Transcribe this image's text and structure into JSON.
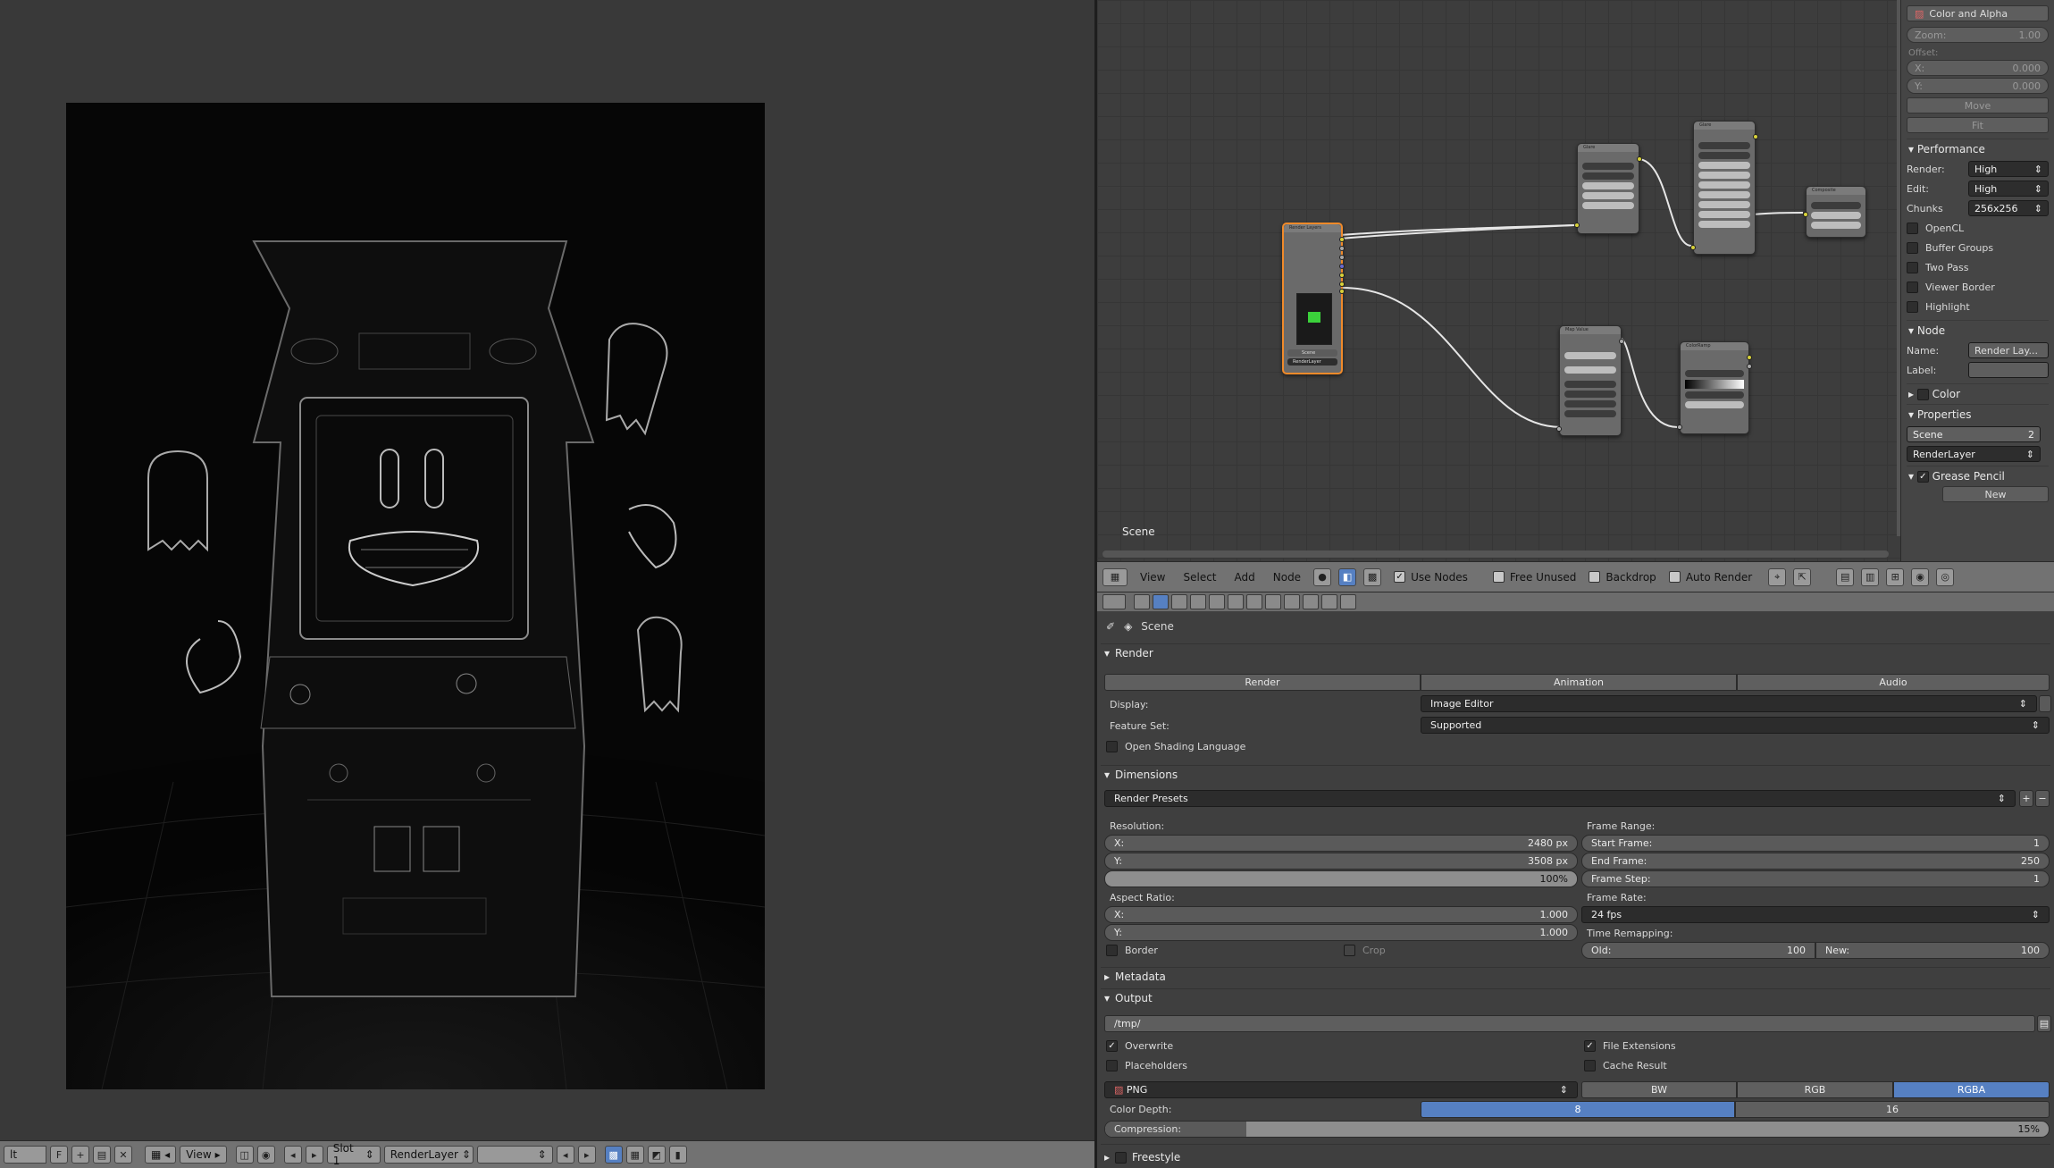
{
  "image_editor": {
    "header": {
      "image_name": "lt",
      "f_label": "F",
      "view_menu": "View",
      "slot": "Slot 1",
      "layer": "RenderLayer"
    }
  },
  "node_editor": {
    "frame_label": "Scene",
    "nodes": {
      "render_layers": "Render Layers",
      "glare1": "Glare",
      "glare2": "Glare",
      "composite": "Composite",
      "map_value": "Map Value",
      "color_ramp": "ColorRamp",
      "render_layer_field": "RenderLayer",
      "scene_field": "Scene"
    },
    "header": {
      "menus": [
        "View",
        "Select",
        "Add",
        "Node"
      ],
      "use_nodes": "Use Nodes",
      "free_unused": "Free Unused",
      "backdrop": "Backdrop",
      "auto_render": "Auto Render"
    }
  },
  "node_props": {
    "color_alpha": "Color and Alpha",
    "zoom_label": "Zoom:",
    "zoom_value": "1.00",
    "offset_label": "Offset:",
    "x_label": "X:",
    "x_value": "0.000",
    "y_label": "Y:",
    "y_value": "0.000",
    "move": "Move",
    "fit": "Fit",
    "performance": "Performance",
    "render_label": "Render:",
    "render_value": "High",
    "edit_label": "Edit:",
    "edit_value": "High",
    "chunks_label": "Chunks",
    "chunks_value": "256x256",
    "opencl": "OpenCL",
    "buffer_groups": "Buffer Groups",
    "two_pass": "Two Pass",
    "viewer_border": "Viewer Border",
    "highlight": "Highlight",
    "node_header": "Node",
    "name_label": "Name:",
    "name_value": "Render Lay...",
    "label_label": "Label:",
    "color_header": "Color",
    "properties_header": "Properties",
    "scene_value": "Scene",
    "scene_count": "2",
    "renderlayer_value": "RenderLayer",
    "grease_pencil": "Grease Pencil",
    "new_btn": "New"
  },
  "properties": {
    "breadcrumb": "Scene",
    "render_section": "Render",
    "render_btn": "Render",
    "animation_btn": "Animation",
    "audio_btn": "Audio",
    "display_label": "Display:",
    "display_value": "Image Editor",
    "feature_set_label": "Feature Set:",
    "feature_set_value": "Supported",
    "osl": "Open Shading Language",
    "dimensions_section": "Dimensions",
    "render_presets": "Render Presets",
    "resolution_label": "Resolution:",
    "res_x_label": "X:",
    "res_x_value": "2480 px",
    "res_y_label": "Y:",
    "res_y_value": "3508 px",
    "res_pct": "100%",
    "aspect_label": "Aspect Ratio:",
    "asp_x_label": "X:",
    "asp_x_value": "1.000",
    "asp_y_label": "Y:",
    "asp_y_value": "1.000",
    "border": "Border",
    "crop": "Crop",
    "frame_range_label": "Frame Range:",
    "start_label": "Start Frame:",
    "start_value": "1",
    "end_label": "End Frame:",
    "end_value": "250",
    "step_label": "Frame Step:",
    "step_value": "1",
    "frame_rate_label": "Frame Rate:",
    "frame_rate_value": "24 fps",
    "time_remap_label": "Time Remapping:",
    "old_label": "Old:",
    "old_value": "100",
    "new_label": "New:",
    "new_value": "100",
    "metadata_section": "Metadata",
    "output_section": "Output",
    "output_path": "/tmp/",
    "overwrite": "Overwrite",
    "file_extensions": "File Extensions",
    "placeholders": "Placeholders",
    "cache_result": "Cache Result",
    "format": "PNG",
    "bw": "BW",
    "rgb": "RGB",
    "rgba": "RGBA",
    "color_depth_label": "Color Depth:",
    "depth_8": "8",
    "depth_16": "16",
    "compression_label": "Compression:",
    "compression_value": "15%",
    "compression_fraction": 0.15,
    "freestyle_section": "Freestyle"
  },
  "colors": {
    "accent_blue": "#5680c2",
    "selected_node_border": "#f08a2a",
    "socket_yellow": "#d8d23a"
  }
}
